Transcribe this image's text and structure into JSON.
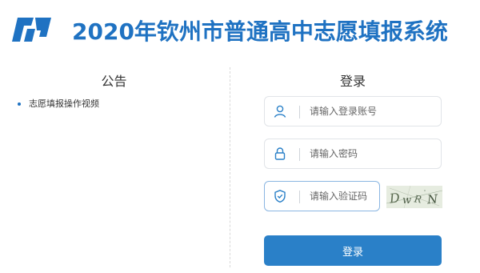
{
  "header": {
    "title": "2020年钦州市普通高中志愿填报系统",
    "brand_color": "#1f72c2"
  },
  "notice": {
    "heading": "公告",
    "items": [
      {
        "label": "志愿填报操作视频"
      }
    ]
  },
  "login": {
    "heading": "登录",
    "username": {
      "placeholder": "请输入登录账号",
      "icon": "user-icon"
    },
    "password": {
      "placeholder": "请输入密码",
      "icon": "lock-icon"
    },
    "captcha": {
      "placeholder": "请输入验证码",
      "icon": "shield-icon",
      "image_text": "DWRN"
    },
    "submit_label": "登录",
    "button_color": "#2a80c8"
  }
}
